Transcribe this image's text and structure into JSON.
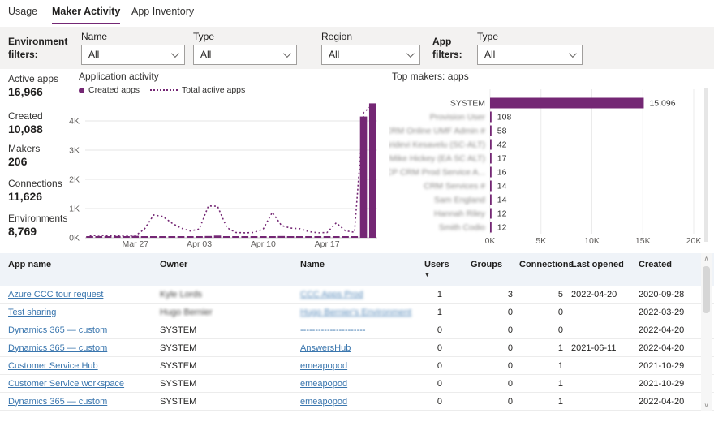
{
  "tabs": [
    {
      "label": "Usage",
      "active": false
    },
    {
      "label": "Maker Activity",
      "active": true
    },
    {
      "label": "App Inventory",
      "active": false
    }
  ],
  "filters": {
    "environment_label": "Environment filters:",
    "app_label": "App filters:",
    "environment": [
      {
        "label": "Name",
        "value": "All"
      },
      {
        "label": "Type",
        "value": "All"
      },
      {
        "label": "Region",
        "value": "All"
      }
    ],
    "app": [
      {
        "label": "Type",
        "value": "All"
      }
    ]
  },
  "stats": [
    {
      "label": "Active apps",
      "value": "16,966"
    },
    {
      "label": "Created",
      "value": "10,088"
    },
    {
      "label": "Makers",
      "value": "206"
    },
    {
      "label": "Connections",
      "value": "11,626"
    },
    {
      "label": "Environments",
      "value": "8,769"
    }
  ],
  "chart_data": [
    {
      "type": "bar",
      "title": "Application activity",
      "legend": [
        {
          "label": "Created apps",
          "marker": "dot"
        },
        {
          "label": "Total active apps",
          "marker": "dotted-line"
        }
      ],
      "x": [
        "Mar 22",
        "Mar 23",
        "Mar 24",
        "Mar 25",
        "Mar 26",
        "Mar 27",
        "Mar 28",
        "Mar 29",
        "Mar 30",
        "Mar 31",
        "Apr 01",
        "Apr 02",
        "Apr 03",
        "Apr 04",
        "Apr 05",
        "Apr 06",
        "Apr 07",
        "Apr 08",
        "Apr 09",
        "Apr 10",
        "Apr 11",
        "Apr 12",
        "Apr 13",
        "Apr 14",
        "Apr 15",
        "Apr 16",
        "Apr 17",
        "Apr 18",
        "Apr 19",
        "Apr 20",
        "Apr 21",
        "Apr 22"
      ],
      "x_ticks": [
        "Mar 27",
        "Apr 03",
        "Apr 10",
        "Apr 17"
      ],
      "x_tick_index": [
        5,
        12,
        19,
        26
      ],
      "y_ticks": [
        "0K",
        "1K",
        "2K",
        "3K",
        "4K"
      ],
      "ylim": [
        0,
        4800
      ],
      "series": [
        {
          "name": "Created apps",
          "type": "bar",
          "values": [
            45,
            55,
            50,
            60,
            50,
            65,
            50,
            45,
            55,
            40,
            35,
            45,
            55,
            60,
            75,
            40,
            35,
            50,
            45,
            55,
            45,
            60,
            40,
            35,
            45,
            40,
            50,
            45,
            55,
            40,
            4150,
            4600
          ]
        },
        {
          "name": "Total active apps",
          "type": "line",
          "values": [
            70,
            90,
            70,
            60,
            65,
            70,
            300,
            780,
            730,
            500,
            330,
            230,
            300,
            1090,
            1080,
            350,
            180,
            170,
            180,
            300,
            870,
            420,
            330,
            310,
            210,
            170,
            180,
            510,
            240,
            190,
            4280,
            4560
          ]
        }
      ]
    },
    {
      "type": "bar",
      "orientation": "horizontal",
      "title": "Top makers: apps",
      "categories": [
        "SYSTEM",
        "Provision User",
        "CRM Online UMF Admin #",
        "Sridevi Kesavelu (SC-ALT)",
        "Mike Hickey (EA SC ALT)",
        "OCP CRM Prod Service A...",
        "CRM Services #",
        "Sam England",
        "Hannah Riley",
        "Smith Codio"
      ],
      "values": [
        15096,
        108,
        58,
        42,
        17,
        16,
        14,
        14,
        12,
        12
      ],
      "value_labels": [
        "15,096",
        "108",
        "58",
        "42",
        "17",
        "16",
        "14",
        "14",
        "12",
        "12"
      ],
      "redacted_from_index": 1,
      "x_ticks": [
        "0K",
        "5K",
        "10K",
        "15K",
        "20K"
      ],
      "xlim": [
        0,
        20000
      ]
    }
  ],
  "table": {
    "columns": [
      "App name",
      "Owner",
      "Name",
      "Users",
      "Groups",
      "Connections",
      "Last opened",
      "Created"
    ],
    "sort_column": "Users",
    "sort_direction": "descending",
    "rows": [
      {
        "app": "Azure CCC tour request",
        "owner": "Kyle Lords",
        "owner_redacted": true,
        "name": "CCC Apps Prod",
        "name_redacted": true,
        "users": "1",
        "groups": "3",
        "connections": "5",
        "last_opened": "2022-04-20",
        "created": "2020-09-28"
      },
      {
        "app": "Test sharing",
        "owner": "Hugo Bernier",
        "owner_redacted": true,
        "name": "Hugo Bernier's Environment",
        "name_redacted": true,
        "users": "1",
        "groups": "0",
        "connections": "0",
        "last_opened": "",
        "created": "2022-03-29"
      },
      {
        "app": "Dynamics 365 — custom",
        "owner": "SYSTEM",
        "owner_redacted": false,
        "name": "----------------------",
        "name_redacted": false,
        "users": "0",
        "groups": "0",
        "connections": "0",
        "last_opened": "",
        "created": "2022-04-20"
      },
      {
        "app": "Dynamics 365 — custom",
        "owner": "SYSTEM",
        "owner_redacted": false,
        "name": "AnswersHub",
        "name_redacted": false,
        "users": "0",
        "groups": "0",
        "connections": "1",
        "last_opened": "2021-06-11",
        "created": "2022-04-20"
      },
      {
        "app": "Customer Service Hub",
        "owner": "SYSTEM",
        "owner_redacted": false,
        "name": "emeapopod",
        "name_redacted": false,
        "users": "0",
        "groups": "0",
        "connections": "1",
        "last_opened": "",
        "created": "2021-10-29"
      },
      {
        "app": "Customer Service workspace",
        "owner": "SYSTEM",
        "owner_redacted": false,
        "name": "emeapopod",
        "name_redacted": false,
        "users": "0",
        "groups": "0",
        "connections": "1",
        "last_opened": "",
        "created": "2021-10-29"
      },
      {
        "app": "Dynamics 365 — custom",
        "owner": "SYSTEM",
        "owner_redacted": false,
        "name": "emeapopod",
        "name_redacted": false,
        "users": "0",
        "groups": "0",
        "connections": "1",
        "last_opened": "",
        "created": "2022-04-20"
      }
    ]
  },
  "icons": {
    "dropdown_chevron": "chevron-down-icon",
    "sort_descending": "▼",
    "scroll_up": "∧",
    "scroll_down": "∨"
  },
  "colors": {
    "accent": "#742774",
    "link": "#3a76ae",
    "filter_bg": "#f3f2f1",
    "table_header_bg": "#eff3f8",
    "grid_line": "#e5e5e5",
    "axis_text": "#605e5c"
  }
}
